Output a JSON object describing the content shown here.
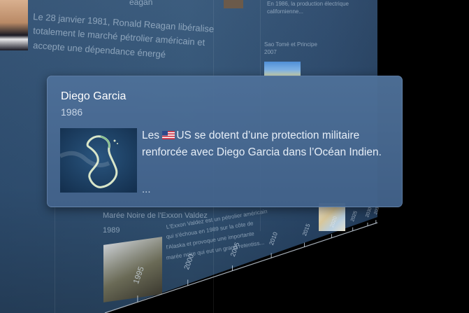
{
  "background": {
    "reagan_entry": {
      "title_fragment": "eagan",
      "lines": [
        "Le 28 janvier 1981, Ronald Reagan libéralise",
        "totalement le marché pétrolier américain et",
        "accepte une dépendance énergé"
      ]
    },
    "top_right_entry": {
      "line1": "En 1986, la production électrique californienne..."
    },
    "sao_tome_entry": {
      "title": "Sao Tomé et Principe",
      "year": "2007"
    },
    "exxon_entry": {
      "title": "Marée Noire de l'Exxon Valdez",
      "year": "1989",
      "lines": [
        "L'Exxon Valdez est un pétrolier américain",
        "qui s'échoua en 1989 sur la côte de",
        "l'Alaska et provoque une importante",
        "marée noire qui eut un grand retentiss..."
      ]
    },
    "axis_years": [
      "1995",
      "2000",
      "2005",
      "2010",
      "2015",
      "2020",
      "2025",
      "2030",
      "2035"
    ]
  },
  "popup": {
    "title": "Diego Garcia",
    "year": "1986",
    "text_prefix": "Les ",
    "text_body": "US se dotent d’une protection militaire renforcée avec Diego Garcia dans l’Océan Indien.",
    "ellipsis": "...",
    "flag_icon": "us-flag-icon",
    "image_icon": "satellite-island-image"
  },
  "colors": {
    "wall": "#345679",
    "popup": "#4e7098",
    "popup_title": "#ffffff",
    "popup_year": "#c7d5e6"
  }
}
